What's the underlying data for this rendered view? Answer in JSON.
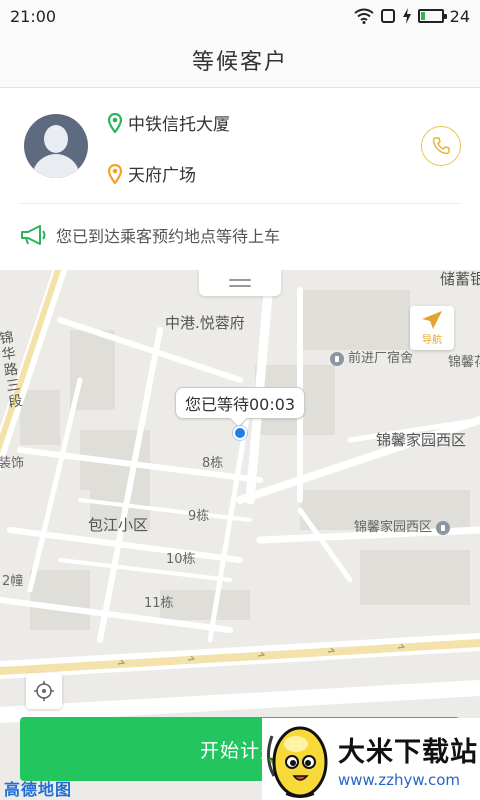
{
  "status_bar": {
    "time": "21:00",
    "battery": "24",
    "battery_level": 0.24
  },
  "header": {
    "title": "等候客户"
  },
  "trip": {
    "pickup": "中铁信托大厦",
    "destination": "天府广场",
    "notice": "您已到达乘客预约地点等待上车"
  },
  "map": {
    "labels": {
      "top_right": "储蓄银",
      "compound": "中港.悦蓉府",
      "factory_dorm": "前进厂宿舍",
      "jinxin_right": "锦馨花",
      "jinxin_area": "锦馨家园西区",
      "jinxin_poi": "锦馨家园西区",
      "road_vertical": "锦华路三段",
      "decor": "装饰",
      "district": "包江小区",
      "building_8": "8栋",
      "building_9": "9栋",
      "building_10": "10栋",
      "building_11": "11栋",
      "building_2": "2幢"
    },
    "wait_bubble": "您已等待00:03",
    "nav_label": "导航",
    "provider": "高德地图"
  },
  "actions": {
    "start_label": "开始计费"
  },
  "watermark": {
    "title": "大米下载站",
    "url": "www.zzhyw.com"
  },
  "colors": {
    "accent_green": "#22c55e",
    "pickup_green": "#2db35a",
    "destination_orange": "#f0a229",
    "user_dot": "#1d7fe6"
  }
}
